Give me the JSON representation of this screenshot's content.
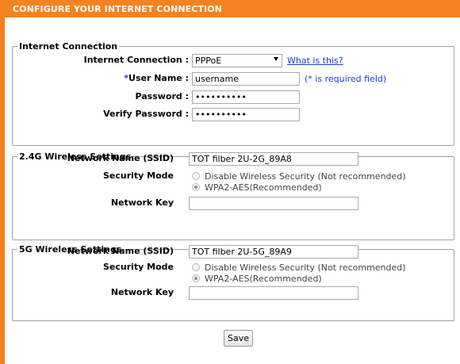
{
  "header": {
    "title": "CONFIGURE YOUR INTERNET CONNECTION"
  },
  "colors": {
    "brand": "#f58220",
    "link": "#1b3bd8"
  },
  "internet": {
    "legend": "Internet Connection",
    "connection_label": "Internet Connection :",
    "connection_value": "PPPoE",
    "what_is_this": "What is this?",
    "required_star": "*",
    "username_label": "User Name :",
    "username_value": "username",
    "required_hint": "(* is required field)",
    "password_label": "Password :",
    "password_value": "••••••••••",
    "verify_label": "Verify Password :",
    "verify_value": "••••••••••"
  },
  "wireless24": {
    "legend": "2.4G Wireless Settings",
    "ssid_label": "Network Name (SSID)",
    "ssid_value": "TOT filber 2U-2G_89A8",
    "security_label": "Security Mode",
    "option_disable": "Disable Wireless Security (Not recommended)",
    "option_wpa2": "WPA2-AES(Recommended)",
    "key_label": "Network Key",
    "key_value": ""
  },
  "wireless5": {
    "legend": "5G Wireless Settings",
    "ssid_label": "Network Name (SSID)",
    "ssid_value": "TOT filber 2U-5G_89A9",
    "security_label": "Security Mode",
    "option_disable": "Disable Wireless Security (Not recommended)",
    "option_wpa2": "WPA2-AES(Recommended)",
    "key_label": "Network Key",
    "key_value": ""
  },
  "actions": {
    "save_label": "Save"
  }
}
